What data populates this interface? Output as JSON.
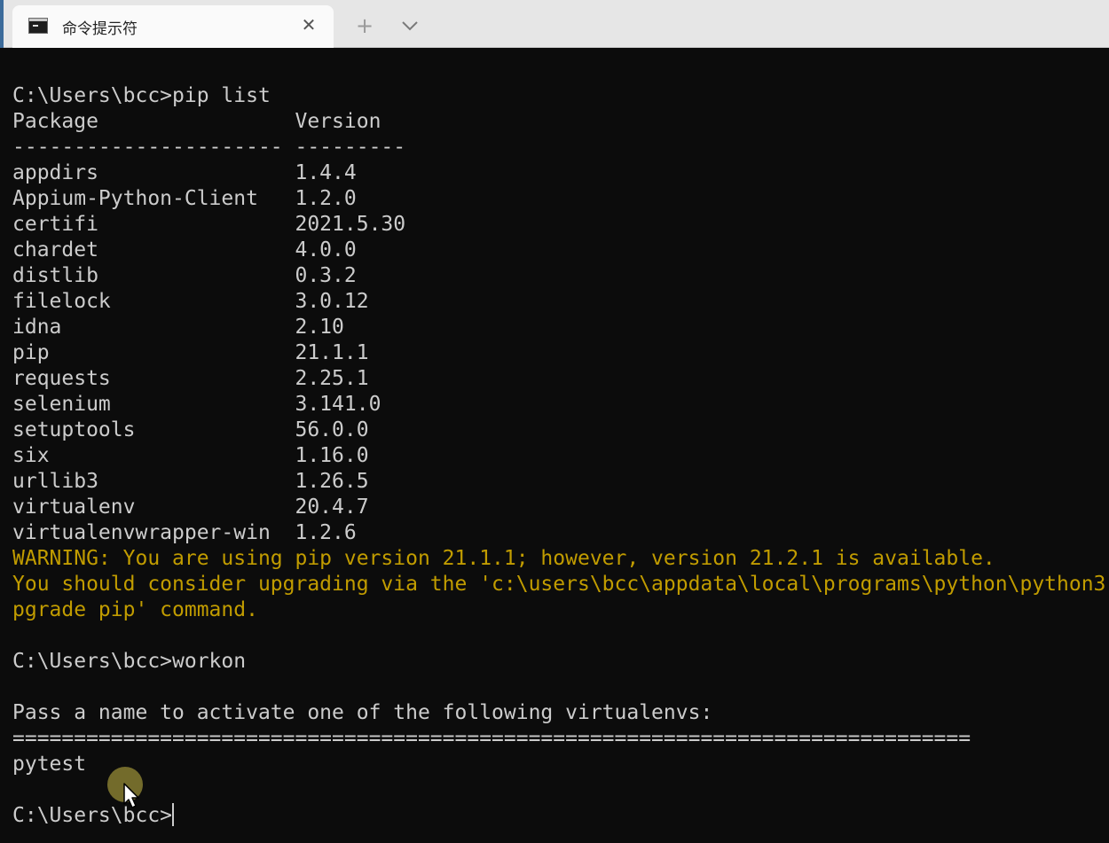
{
  "window": {
    "tab_title": "命令提示符",
    "tab_close_glyph": "✕",
    "new_tab_glyph": "+",
    "dropdown_icon": "chevron-down-icon"
  },
  "colors": {
    "background": "#0c0c0c",
    "foreground": "#cccccc",
    "warning": "#c19c00",
    "tabbar": "#e6e6e6",
    "tab_active": "#fafafa"
  },
  "terminal": {
    "lines": [
      {
        "text": "C:\\Users\\bcc>pip list",
        "kind": "normal"
      },
      {
        "text": "Package                Version",
        "kind": "normal"
      },
      {
        "text": "---------------------- ---------",
        "kind": "normal"
      },
      {
        "text": "appdirs                1.4.4",
        "kind": "normal"
      },
      {
        "text": "Appium-Python-Client   1.2.0",
        "kind": "normal"
      },
      {
        "text": "certifi                2021.5.30",
        "kind": "normal"
      },
      {
        "text": "chardet                4.0.0",
        "kind": "normal"
      },
      {
        "text": "distlib                0.3.2",
        "kind": "normal"
      },
      {
        "text": "filelock               3.0.12",
        "kind": "normal"
      },
      {
        "text": "idna                   2.10",
        "kind": "normal"
      },
      {
        "text": "pip                    21.1.1",
        "kind": "normal"
      },
      {
        "text": "requests               2.25.1",
        "kind": "normal"
      },
      {
        "text": "selenium               3.141.0",
        "kind": "normal"
      },
      {
        "text": "setuptools             56.0.0",
        "kind": "normal"
      },
      {
        "text": "six                    1.16.0",
        "kind": "normal"
      },
      {
        "text": "urllib3                1.26.5",
        "kind": "normal"
      },
      {
        "text": "virtualenv             20.4.7",
        "kind": "normal"
      },
      {
        "text": "virtualenvwrapper-win  1.2.6",
        "kind": "normal"
      },
      {
        "text": "WARNING: You are using pip version 21.1.1; however, version 21.2.1 is available.",
        "kind": "warn"
      },
      {
        "text": "You should consider upgrading via the 'c:\\users\\bcc\\appdata\\local\\programs\\python\\python3",
        "kind": "warn"
      },
      {
        "text": "pgrade pip' command.",
        "kind": "warn"
      },
      {
        "text": "",
        "kind": "normal"
      },
      {
        "text": "C:\\Users\\bcc>workon",
        "kind": "normal"
      },
      {
        "text": "",
        "kind": "normal"
      },
      {
        "text": "Pass a name to activate one of the following virtualenvs:",
        "kind": "normal"
      },
      {
        "text": "==============================================================================",
        "kind": "normal"
      },
      {
        "text": "pytest",
        "kind": "normal"
      },
      {
        "text": "",
        "kind": "normal"
      }
    ],
    "prompt": "C:\\Users\\bcc>"
  }
}
